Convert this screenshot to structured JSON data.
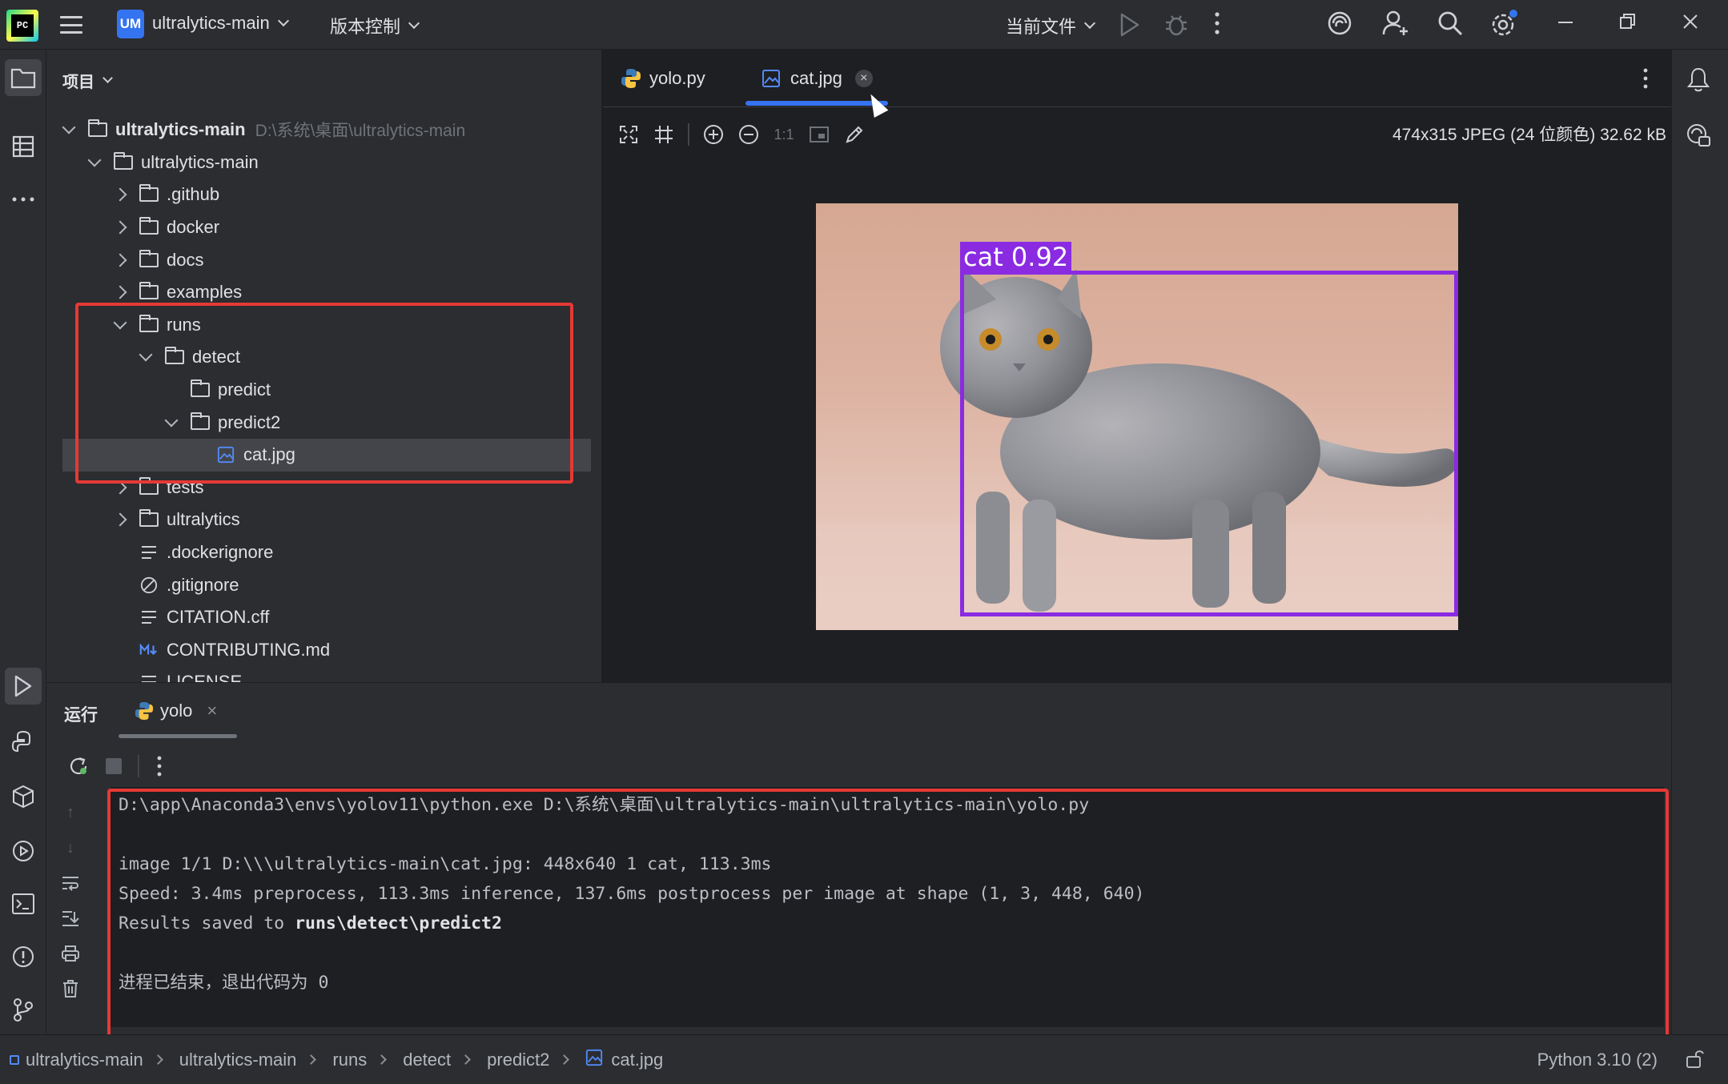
{
  "titlebar": {
    "logo": "PC",
    "project_badge": "UM",
    "project_name": "ultralytics-main",
    "vcs_menu": "版本控制",
    "run_config": "当前文件"
  },
  "project_panel": {
    "header": "项目",
    "tree": [
      {
        "label": "ultralytics-main",
        "hint": "D:\\系统\\桌面\\ultralytics-main",
        "depth": 0,
        "kind": "folder",
        "state": "open",
        "bold": true
      },
      {
        "label": "ultralytics-main",
        "depth": 1,
        "kind": "folder",
        "state": "open"
      },
      {
        "label": ".github",
        "depth": 2,
        "kind": "folder",
        "state": "closed"
      },
      {
        "label": "docker",
        "depth": 2,
        "kind": "folder",
        "state": "closed"
      },
      {
        "label": "docs",
        "depth": 2,
        "kind": "folder",
        "state": "closed"
      },
      {
        "label": "examples",
        "depth": 2,
        "kind": "folder",
        "state": "closed"
      },
      {
        "label": "runs",
        "depth": 2,
        "kind": "folder",
        "state": "open"
      },
      {
        "label": "detect",
        "depth": 3,
        "kind": "folder",
        "state": "open"
      },
      {
        "label": "predict",
        "depth": 4,
        "kind": "folder",
        "state": "none"
      },
      {
        "label": "predict2",
        "depth": 4,
        "kind": "folder",
        "state": "open"
      },
      {
        "label": "cat.jpg",
        "depth": 5,
        "kind": "image",
        "state": "none",
        "selected": true
      },
      {
        "label": "tests",
        "depth": 2,
        "kind": "folder",
        "state": "closed"
      },
      {
        "label": "ultralytics",
        "depth": 2,
        "kind": "folder",
        "state": "closed"
      },
      {
        "label": ".dockerignore",
        "depth": 2,
        "kind": "text",
        "state": "none"
      },
      {
        "label": ".gitignore",
        "depth": 2,
        "kind": "ignore",
        "state": "none"
      },
      {
        "label": "CITATION.cff",
        "depth": 2,
        "kind": "text",
        "state": "none"
      },
      {
        "label": "CONTRIBUTING.md",
        "depth": 2,
        "kind": "md",
        "state": "none"
      },
      {
        "label": "LICENSE",
        "depth": 2,
        "kind": "text",
        "state": "none"
      }
    ]
  },
  "editor": {
    "tabs": [
      {
        "label": "yolo.py",
        "icon": "python-icon"
      },
      {
        "label": "cat.jpg",
        "icon": "image-icon",
        "active": true
      }
    ],
    "image_info": "474x315 JPEG (24 位颜色) 32.62 kB",
    "zoom_1to1": "1:1",
    "detection_label": "cat 0.92"
  },
  "run_panel": {
    "title": "运行",
    "tab": "yolo",
    "console": [
      {
        "text": "D:\\app\\Anaconda3\\envs\\yolov11\\python.exe D:\\系统\\桌面\\ultralytics-main\\ultralytics-main\\yolo.py"
      },
      {
        "text": ""
      },
      {
        "text": "image 1/1 D:\\\\\\ultralytics-main\\cat.jpg: 448x640 1 cat, 113.3ms"
      },
      {
        "text": "Speed: 3.4ms preprocess, 113.3ms inference, 137.6ms postprocess per image at shape (1, 3, 448, 640)"
      },
      {
        "text": "Results saved to ",
        "bold": "runs\\detect\\predict2"
      },
      {
        "text": ""
      },
      {
        "text": "进程已结束，退出代码为 0"
      }
    ]
  },
  "statusbar": {
    "breadcrumbs": [
      "ultralytics-main",
      "ultralytics-main",
      "runs",
      "detect",
      "predict2",
      "cat.jpg"
    ],
    "interpreter": "Python 3.10 (2)"
  },
  "colors": {
    "accent": "#3574f0",
    "highlight_box": "#e53935",
    "bbox": "#8a2be2"
  }
}
